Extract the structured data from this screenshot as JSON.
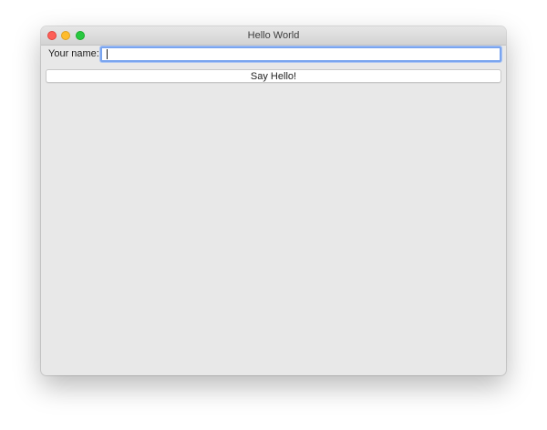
{
  "window": {
    "title": "Hello World"
  },
  "traffic_lights": {
    "close_color": "#fe5f57",
    "minimize_color": "#febc2e",
    "maximize_color": "#28c840"
  },
  "form": {
    "name_label": "Your name:",
    "name_value": "",
    "name_focus_color": "#7aa5ef",
    "button_label": "Say Hello!"
  }
}
